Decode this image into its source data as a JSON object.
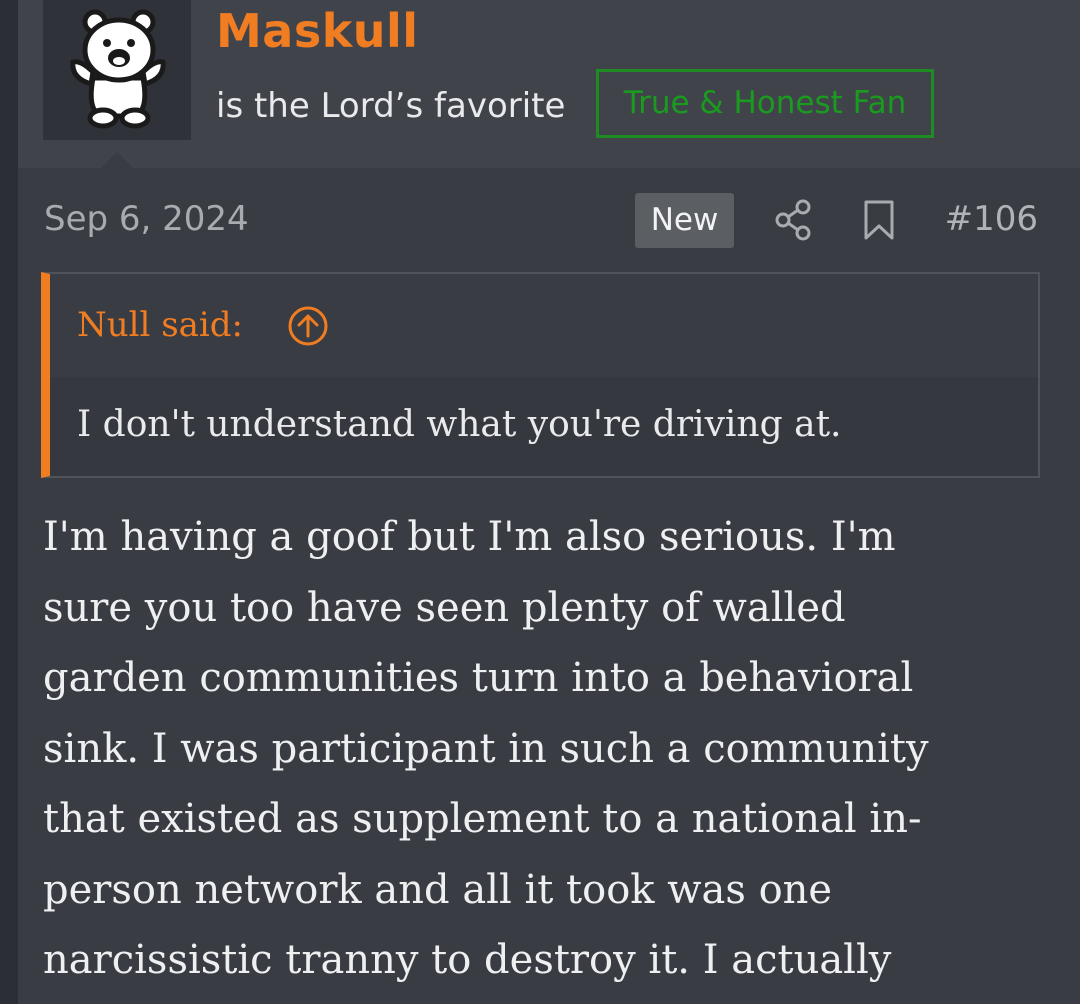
{
  "user": {
    "name": "Maskull",
    "title": "is the Lord’s favorite",
    "badge": "True & Honest Fan"
  },
  "post_meta": {
    "date": "Sep 6, 2024",
    "new_label": "New",
    "post_number": "#106",
    "icons": [
      "share-icon",
      "bookmark-icon"
    ]
  },
  "quote": {
    "author": "Null said:",
    "text": "I don't understand what you're driving at."
  },
  "post_body": {
    "lines": [
      "I'm having a goof but I'm also serious. I'm",
      "sure you too have seen plenty of walled",
      "garden communities turn into a behavioral",
      "sink. I was participant in such a community",
      "that existed as supplement to a national in-",
      "person network and all it took was one",
      "narcissistic tranny to destroy it. I actually"
    ]
  },
  "colors": {
    "accent": "#f07d22",
    "badge_green": "#1f8b24",
    "background": "#393c42",
    "header_background": "#40434a"
  }
}
